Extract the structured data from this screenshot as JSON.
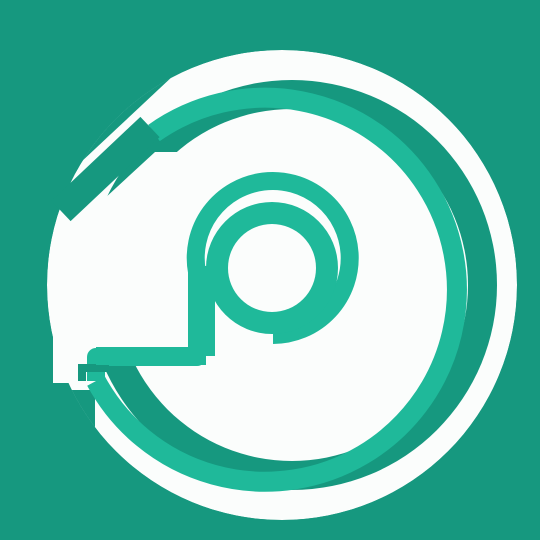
{
  "app_icon": {
    "colors": {
      "background": "#16987f",
      "mark": "#fbfdfc",
      "accent": "#1fb99a"
    },
    "icon_name": "circular-p-logo-icon"
  }
}
